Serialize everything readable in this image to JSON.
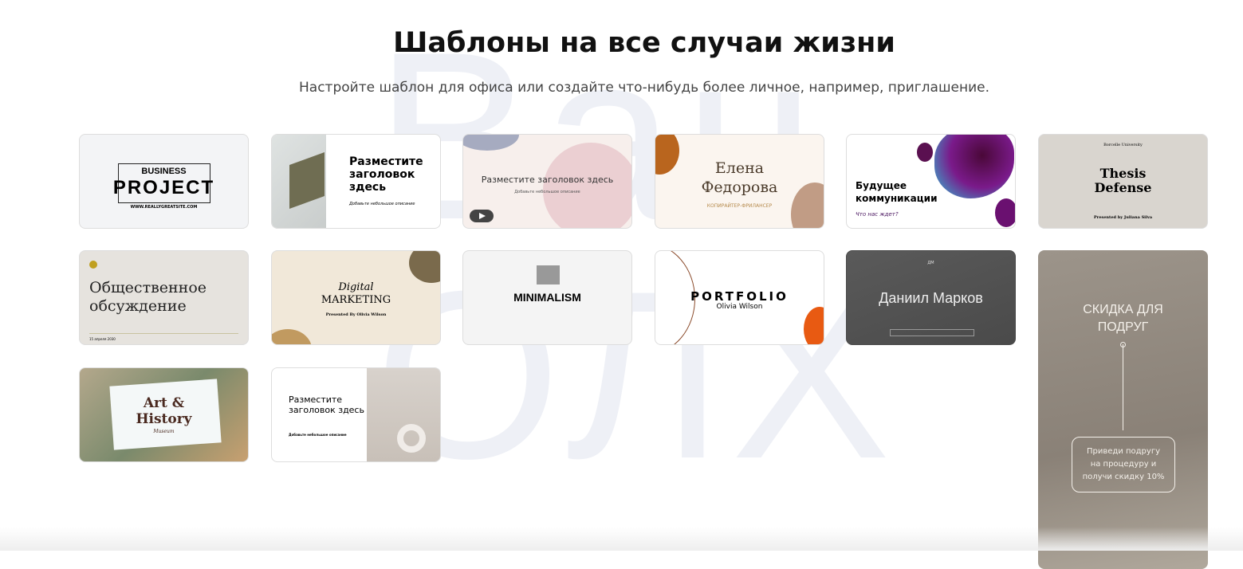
{
  "watermark": "Ван ОЛХ",
  "header": {
    "title": "Шаблоны на все случаи жизни",
    "subtitle": "Настройте шаблон для офиса или создайте что-нибудь более личное, например, приглашение."
  },
  "templates": [
    {
      "title": "BUSINESS",
      "title2": "PROJECT",
      "url": "WWW.REALLYGREATSITE.COM"
    },
    {
      "title": "Разместите заголовок здесь",
      "desc": "Добавьте небольшое описание"
    },
    {
      "title": "Разместите заголовок здесь",
      "desc": "Добавьте небольшое описание",
      "play": "play-icon"
    },
    {
      "title": "Елена Федорова",
      "desc": "КОПИРАЙТЕР-ФРИЛАНСЕР"
    },
    {
      "title": "Будущее коммуникации",
      "desc": "Что нас ждет?"
    },
    {
      "top": "Borcelle University",
      "title": "Thesis Defense",
      "desc": "Presented by Juliana Silva"
    },
    {
      "title": "Общественное обсуждение",
      "date": "15 апреля 2030"
    },
    {
      "title": "Digital",
      "title2": "MARKETING",
      "desc": "Presented By Olivia Wilson"
    },
    {
      "title": "MINIMALISM"
    },
    {
      "title": "PORTFOLIO",
      "desc": "Olivia Wilson"
    },
    {
      "top": "ДМ",
      "title": "Даниил Марков"
    },
    {
      "title": "СКИДКА ДЛЯ ПОДРУГ",
      "desc": "Приведи подругу на процедуру и получи скидку 10%"
    },
    {
      "title": "Art &",
      "title2": "History",
      "desc": "Museum"
    },
    {
      "title": "Разместите заголовок здесь",
      "desc": "Добавьте небольшое описание"
    }
  ]
}
